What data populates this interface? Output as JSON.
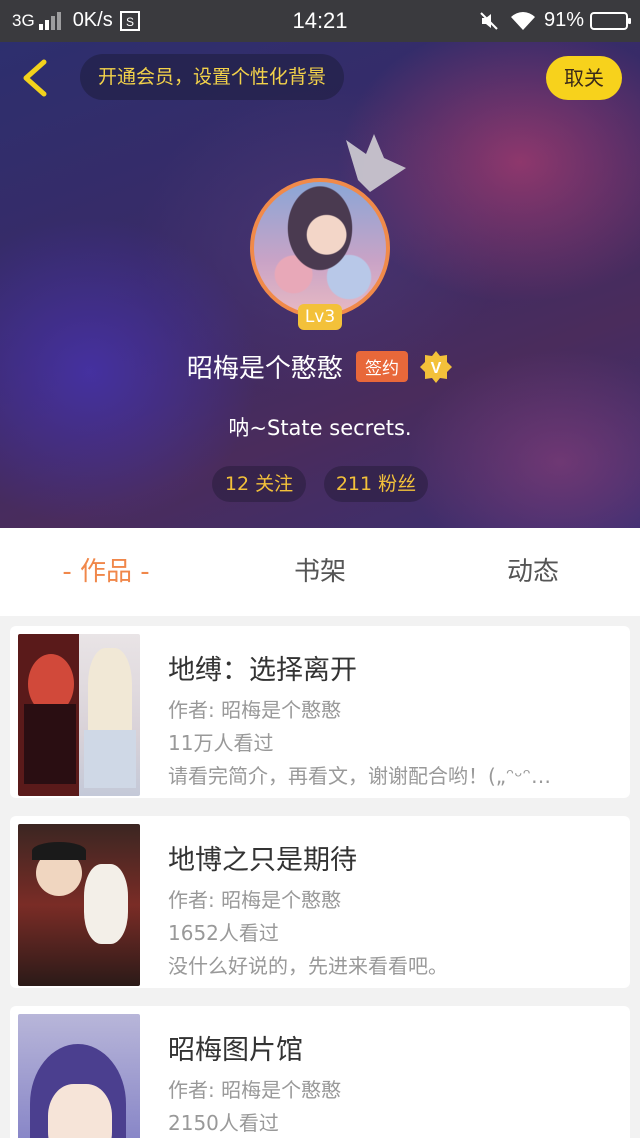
{
  "status_bar": {
    "network": "3G",
    "speed": "0K/s",
    "time": "14:21",
    "battery": "91%",
    "battery_level": 0.91
  },
  "header": {
    "vip_banner": "开通会员，设置个性化背景",
    "unfollow_label": "取关",
    "level": "Lv3",
    "username": "昭梅是个憨憨",
    "signed_badge": "签约",
    "v_badge": "V",
    "bio": "呐~State secrets.",
    "following": "12 关注",
    "fans": "211 粉丝"
  },
  "tabs": [
    {
      "label": "- 作品 -",
      "active": true
    },
    {
      "label": "书架",
      "active": false
    },
    {
      "label": "动态",
      "active": false
    }
  ],
  "works": [
    {
      "title": "地缚：选择离开",
      "author": "作者: 昭梅是个憨憨",
      "views": "11万人看过",
      "desc": "请看完简介，再看文，谢谢配合哟！(„ᵔᵕᵔ…"
    },
    {
      "title": "地博之只是期待",
      "author": "作者: 昭梅是个憨憨",
      "views": "1652人看过",
      "desc": "没什么好说的，先进来看看吧。"
    },
    {
      "title": "昭梅图片馆",
      "author": "作者: 昭梅是个憨憨",
      "views": "2150人看过",
      "desc": ""
    }
  ],
  "colors": {
    "accent": "#f0874a",
    "gold": "#f3c13a",
    "unfollow_bg": "#f7d21c"
  }
}
